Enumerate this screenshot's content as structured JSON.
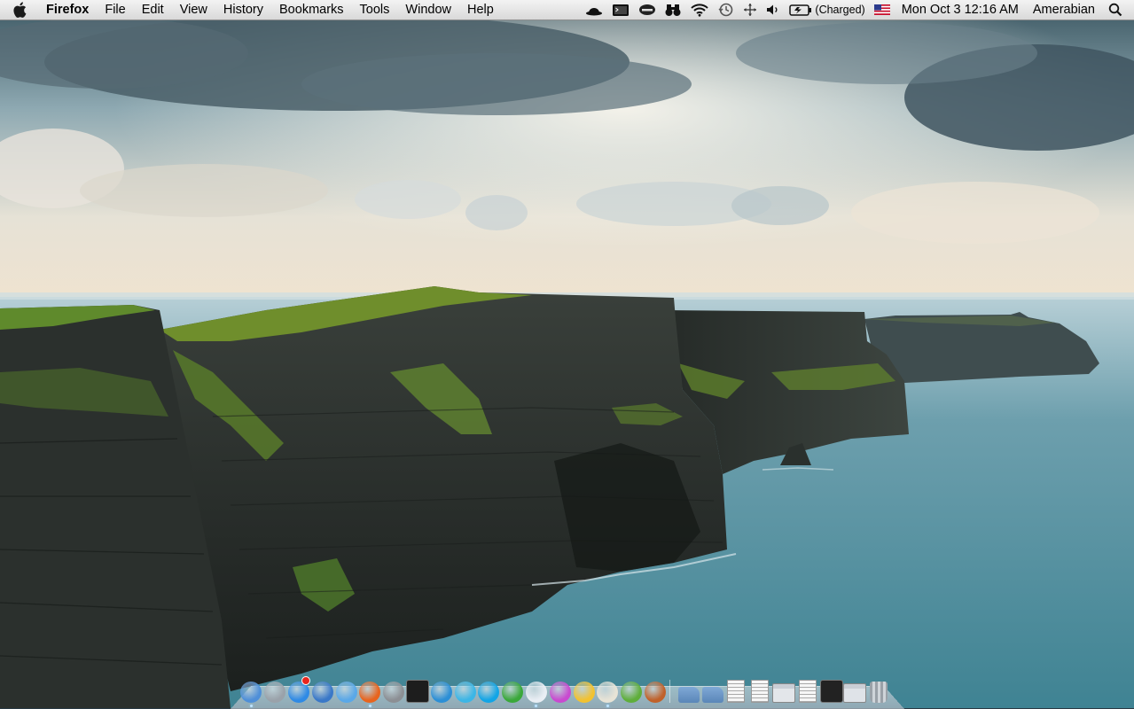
{
  "menubar": {
    "apple_icon": "apple-logo-icon",
    "app_name": "Firefox",
    "menus": [
      "File",
      "Edit",
      "View",
      "History",
      "Bookmarks",
      "Tools",
      "Window",
      "Help"
    ],
    "status_icons": [
      "hat-icon",
      "terminal-icon",
      "spy-icon",
      "binoculars-icon",
      "wifi-icon",
      "time-machine-icon",
      "move-icon",
      "volume-icon"
    ],
    "battery_text": "(Charged)",
    "input_flag": "us-flag-icon",
    "clock": "Mon Oct 3  12:16 AM",
    "user": "Amerabian",
    "spotlight_icon": "spotlight-search-icon"
  },
  "dock": {
    "apps": [
      {
        "name": "finder",
        "icon": "finder-icon",
        "color": "#4f8fd8",
        "running": true
      },
      {
        "name": "launchpad",
        "icon": "launchpad-icon",
        "color": "#9aa2aa",
        "running": false
      },
      {
        "name": "app-store",
        "icon": "app-store-icon",
        "color": "#2f8ae5",
        "running": false,
        "badge": true
      },
      {
        "name": "itunes",
        "icon": "itunes-icon",
        "color": "#3a78c8",
        "running": false
      },
      {
        "name": "safari",
        "icon": "safari-icon",
        "color": "#5aa8e8",
        "running": false
      },
      {
        "name": "firefox",
        "icon": "firefox-icon",
        "color": "#e8641e",
        "running": true
      },
      {
        "name": "system-preferences",
        "icon": "gear-icon",
        "color": "#8c8f94",
        "running": false
      },
      {
        "name": "terminal",
        "icon": "terminal-icon",
        "color": "#1d1d1d",
        "running": false
      },
      {
        "name": "twitter",
        "icon": "twitter-icon",
        "color": "#2c8fd6",
        "running": false
      },
      {
        "name": "messenger",
        "icon": "messenger-icon",
        "color": "#3cb6e6",
        "running": false
      },
      {
        "name": "skype",
        "icon": "skype-icon",
        "color": "#12a5e6",
        "running": false
      },
      {
        "name": "utorrent",
        "icon": "utorrent-icon",
        "color": "#3aa83a",
        "running": false
      },
      {
        "name": "calendar",
        "icon": "calendar-icon",
        "color": "#e9eef4",
        "running": true
      },
      {
        "name": "photo-app",
        "icon": "photos-icon",
        "color": "#c94ad0",
        "running": false
      },
      {
        "name": "weather",
        "icon": "weather-icon",
        "color": "#f2c230",
        "running": false
      },
      {
        "name": "notes",
        "icon": "notes-icon",
        "color": "#e7e3d6",
        "running": true
      },
      {
        "name": "leaf-app",
        "icon": "leaf-icon",
        "color": "#5fae3b",
        "running": false
      },
      {
        "name": "globe-app",
        "icon": "globe-icon",
        "color": "#c0612a",
        "running": false
      }
    ],
    "stacks": [
      {
        "name": "applications-folder",
        "icon": "folder-icon",
        "color": "#7fa9d6"
      },
      {
        "name": "documents-folder",
        "icon": "folder-icon",
        "color": "#7fa9d6"
      },
      {
        "name": "document-1",
        "icon": "document-icon",
        "color": "#f2f2f2"
      },
      {
        "name": "document-2",
        "icon": "document-icon",
        "color": "#dcdcdc"
      },
      {
        "name": "window-preview-1",
        "icon": "window-icon",
        "color": "#e3e6ea"
      },
      {
        "name": "document-3",
        "icon": "document-icon",
        "color": "#e9e9e9"
      },
      {
        "name": "terminal-window",
        "icon": "terminal-icon",
        "color": "#222222"
      },
      {
        "name": "window-preview-2",
        "icon": "window-icon",
        "color": "#dfe3e8"
      },
      {
        "name": "trash",
        "icon": "trash-icon",
        "color": "#b8bec4"
      }
    ]
  },
  "colors": {
    "menubar_bg": "#e6e6e6",
    "sky_top": "#3d5763",
    "sky_horizon": "#e9dcc8",
    "sea": "#4a8a9c",
    "cliff": "#2e3430",
    "grass": "#6f8e2c"
  }
}
